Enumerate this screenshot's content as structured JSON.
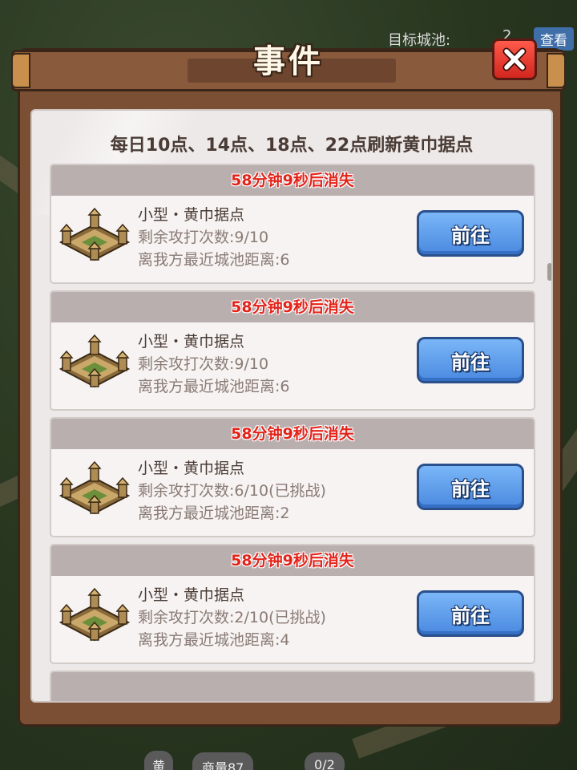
{
  "background": {
    "target_city_label": "目标城池:",
    "target_city_value": "2",
    "view_button": "查看",
    "bottom_chip_left": "黄",
    "bottom_chip_mid": "商量87",
    "bottom_chip_right": "0/2"
  },
  "dialog": {
    "title": "事件",
    "close_icon": "close-x-icon",
    "notice": "每日10点、14点、18点、22点刷新黄巾据点",
    "colors": {
      "countdown": "#e3231a",
      "go_button": "#4a89e0",
      "frame": "#7a4f34"
    }
  },
  "events": [
    {
      "countdown": "58分钟9秒后消失",
      "name": "小型・黄巾据点",
      "attempts": "剩余攻打次数:9/10",
      "distance": "离我方最近城池距离:6",
      "button": "前往",
      "icon": "fortress-icon"
    },
    {
      "countdown": "58分钟9秒后消失",
      "name": "小型・黄巾据点",
      "attempts": "剩余攻打次数:9/10",
      "distance": "离我方最近城池距离:6",
      "button": "前往",
      "icon": "fortress-icon"
    },
    {
      "countdown": "58分钟9秒后消失",
      "name": "小型・黄巾据点",
      "attempts": "剩余攻打次数:6/10(已挑战)",
      "distance": "离我方最近城池距离:2",
      "button": "前往",
      "icon": "fortress-icon"
    },
    {
      "countdown": "58分钟9秒后消失",
      "name": "小型・黄巾据点",
      "attempts": "剩余攻打次数:2/10(已挑战)",
      "distance": "离我方最近城池距离:4",
      "button": "前往",
      "icon": "fortress-icon"
    }
  ]
}
